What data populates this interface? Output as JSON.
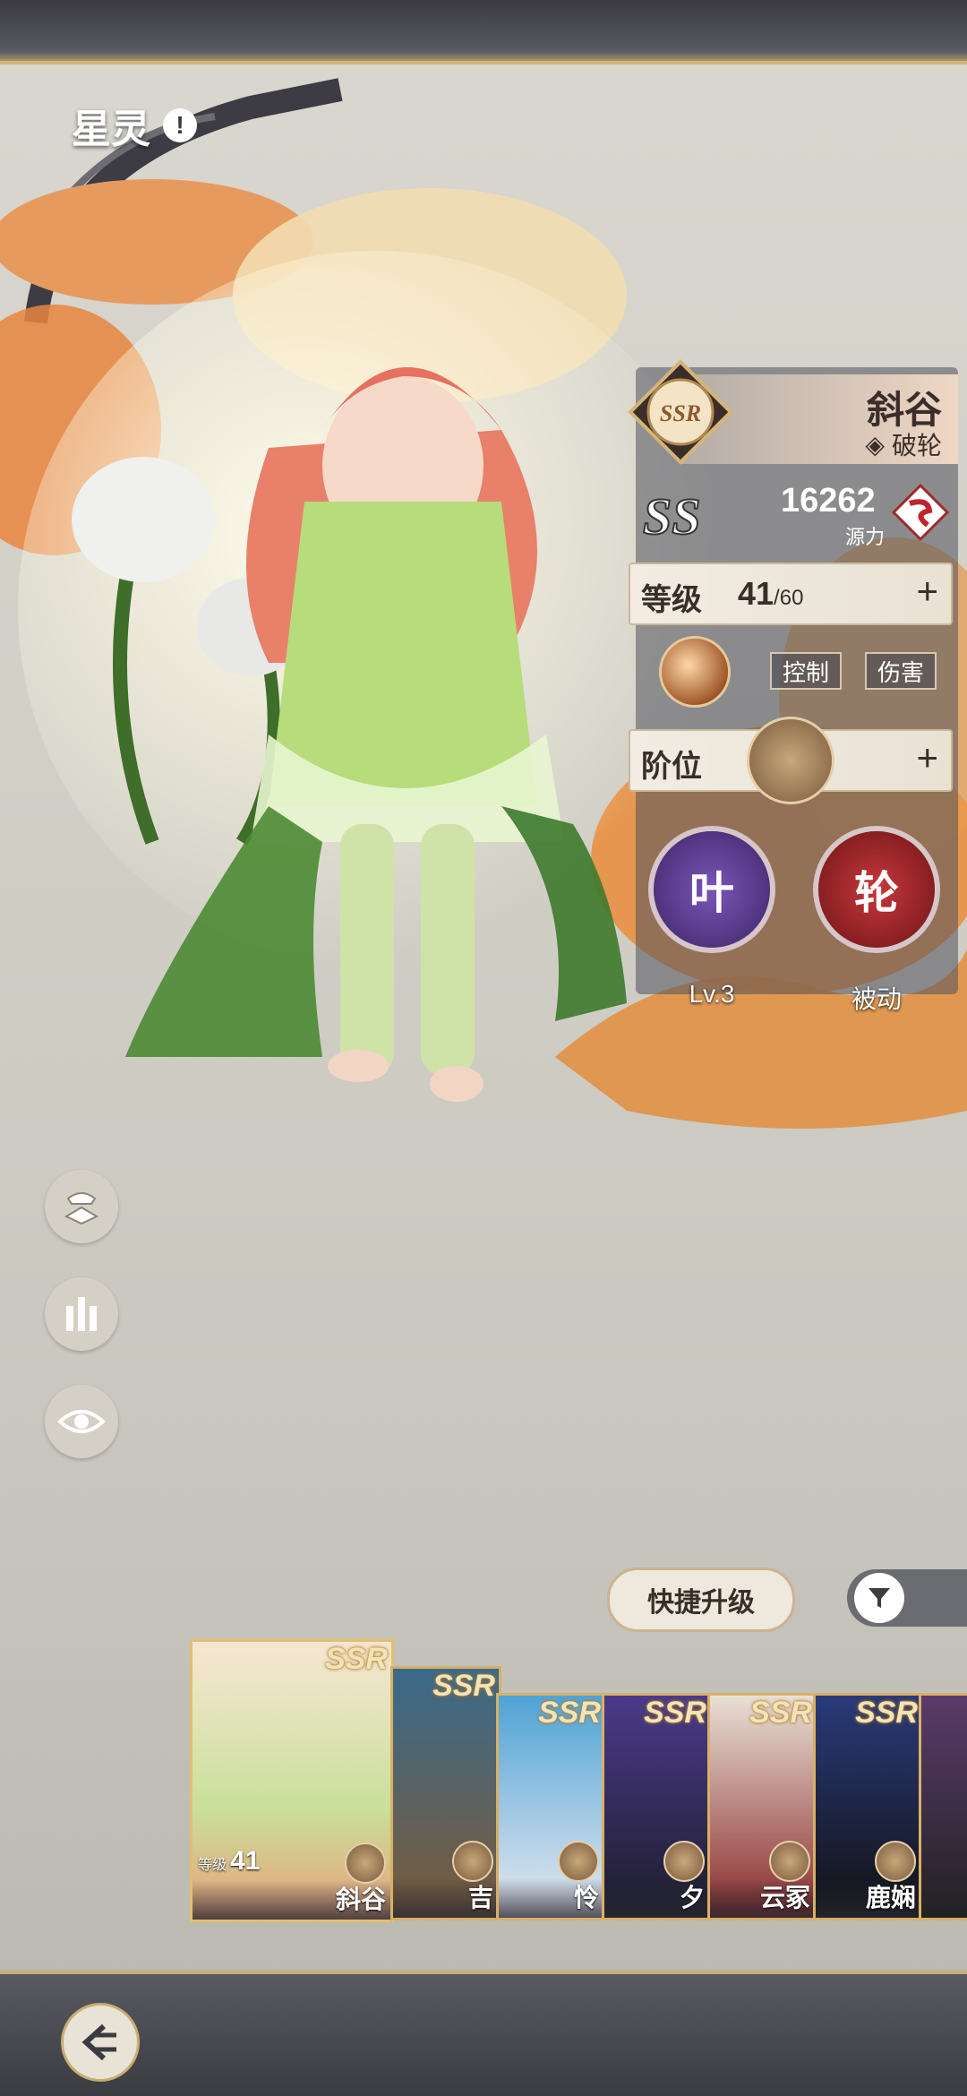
{
  "header": {
    "title": "星灵",
    "info_glyph": "!"
  },
  "character": {
    "rarity": "SSR",
    "name": "斜谷",
    "class": "破轮",
    "power_value": "16262",
    "power_label": "源力",
    "level_label": "等级",
    "level_value": "41",
    "level_max": "/60",
    "tags": [
      "控制",
      "伤害"
    ],
    "rank_label": "阶位",
    "skills": [
      {
        "glyph": "叶",
        "label": "Lv.3",
        "color": "#5b3a8c"
      },
      {
        "glyph": "轮",
        "label": "被动",
        "color": "#a8242b"
      }
    ]
  },
  "side_buttons": [
    "outfit-icon",
    "tower-icon",
    "eye-icon"
  ],
  "actions": {
    "quick_upgrade": "快捷升级",
    "filter_icon": "filter-icon"
  },
  "roster": {
    "selected": {
      "rarity": "SSR",
      "name": "斜谷",
      "level_label": "等级",
      "level": "41"
    },
    "cards": [
      {
        "rarity": "SSR",
        "name": "吉"
      },
      {
        "rarity": "SSR",
        "name": "怜"
      },
      {
        "rarity": "SSR",
        "name": "夕"
      },
      {
        "rarity": "SSR",
        "name": "云冢"
      },
      {
        "rarity": "SSR",
        "name": "鹿娴"
      }
    ]
  },
  "colors": {
    "accent_gold": "#c9ad72",
    "panel": "#50525c"
  }
}
